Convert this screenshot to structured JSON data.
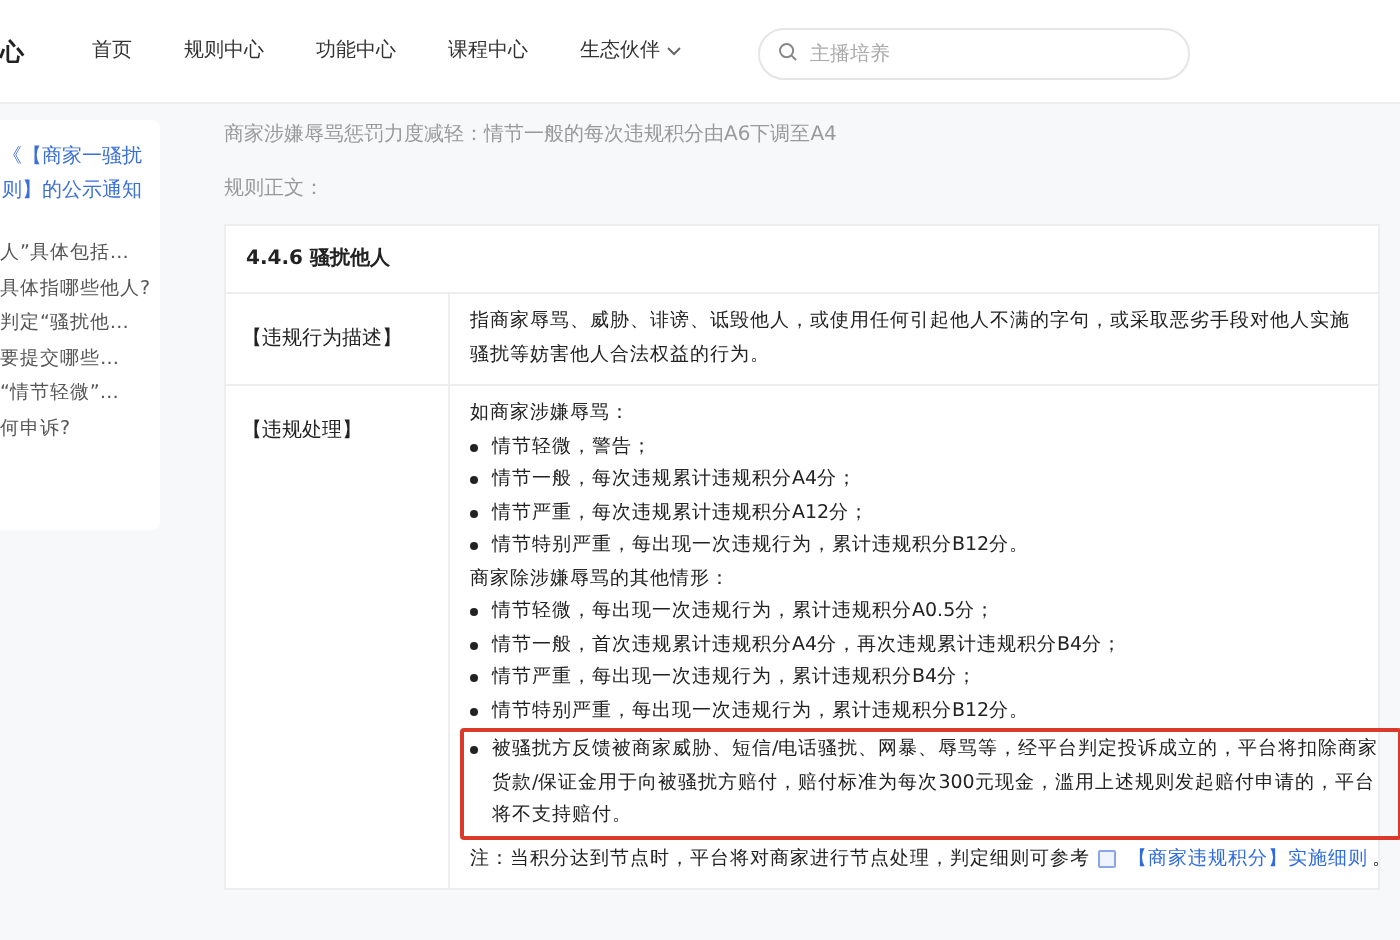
{
  "logo": {
    "text": "心"
  },
  "nav": {
    "items": [
      {
        "label": "首页",
        "selected": false,
        "has_menu": false
      },
      {
        "label": "规则中心",
        "selected": false,
        "has_menu": false
      },
      {
        "label": "功能中心",
        "selected": false,
        "has_menu": false
      },
      {
        "label": "课程中心",
        "selected": false,
        "has_menu": false
      },
      {
        "label": "生态伙伴",
        "selected": false,
        "has_menu": true
      }
    ],
    "search": {
      "placeholder": "主播培养"
    }
  },
  "sidebar": {
    "title_lines": [
      "《【商家一骚扰",
      "则】的公示通知"
    ],
    "items": [
      "人”具体包括…",
      "具体指哪些他人?",
      "判定“骚扰他…",
      "要提交哪些…",
      "“情节轻微”…",
      "何申诉?"
    ]
  },
  "article": {
    "subtitle": "商家涉嫌辱骂惩罚力度减轻：情节一般的每次违规积分由A6下调至A4",
    "body_label": "规则正文：",
    "table": {
      "heading": "4.4.6 骚扰他人",
      "rows": [
        {
          "label": "【违规行为描述】",
          "lines": [
            {
              "kind": "text",
              "text": "指商家辱骂、威胁、诽谤、诋毁他人，或使用任何引起他人不满的字句，或采取恶劣手段对他人实施骚扰等妨害他人合法权益的行为。",
              "boxed": false
            }
          ]
        },
        {
          "label": "【违规处理】",
          "lines": [
            {
              "kind": "text",
              "text": "如商家涉嫌辱骂：",
              "boxed": false
            },
            {
              "kind": "bullet",
              "text": "情节轻微，警告；",
              "boxed": false
            },
            {
              "kind": "bullet",
              "text": "情节一般，每次违规累计违规积分A4分；",
              "boxed": false
            },
            {
              "kind": "bullet",
              "text": "情节严重，每次违规累计违规积分A12分；",
              "boxed": false
            },
            {
              "kind": "bullet",
              "text": "情节特别严重，每出现一次违规行为，累计违规积分B12分。",
              "boxed": false
            },
            {
              "kind": "text",
              "text": "商家除涉嫌辱骂的其他情形：",
              "boxed": false
            },
            {
              "kind": "bullet",
              "text": "情节轻微，每出现一次违规行为，累计违规积分A0.5分；",
              "boxed": false
            },
            {
              "kind": "bullet",
              "text": "情节一般，首次违规累计违规积分A4分，再次违规累计违规积分B4分；",
              "boxed": false
            },
            {
              "kind": "bullet",
              "text": "情节严重，每出现一次违规行为，累计违规积分B4分；",
              "boxed": false
            },
            {
              "kind": "bullet",
              "text": "情节特别严重，每出现一次违规行为，累计违规积分B12分。",
              "boxed": false
            },
            {
              "kind": "bullet",
              "text": "被骚扰方反馈被商家威胁、短信/电话骚扰、网暴、辱骂等，经平台判定投诉成立的，平台将扣除商家货款/保证金用于向被骚扰方赔付，赔付标准为每次300元现金，滥用上述规则发起赔付申请的，平台将不支持赔付。",
              "boxed": true
            }
          ],
          "note": {
            "text": "注：当积分达到节点时，平台将对商家进行节点处理，判定细则可参考",
            "link": "【商家违规积分】实施细则",
            "end": "。"
          }
        }
      ]
    }
  }
}
